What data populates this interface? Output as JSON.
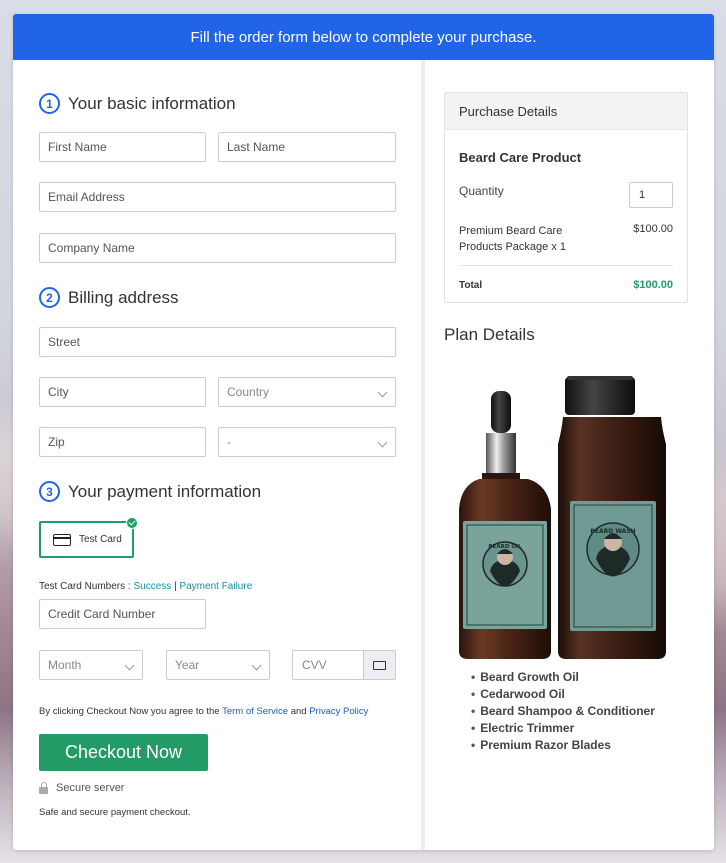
{
  "banner": {
    "text": "Fill the order form below to complete your purchase."
  },
  "basic_info": {
    "step": "1",
    "title": "Your basic information",
    "first_name_placeholder": "First Name",
    "last_name_placeholder": "Last Name",
    "email_placeholder": "Email Address",
    "company_placeholder": "Company Name"
  },
  "billing": {
    "step": "2",
    "title": "Billing address",
    "street_placeholder": "Street",
    "city_placeholder": "City",
    "country_selected": "Country",
    "zip_placeholder": "Zip",
    "state_selected": "-"
  },
  "payment": {
    "step": "3",
    "title": "Your payment information",
    "test_card_label": "Test Card",
    "test_numbers_prefix": "Test Card Numbers :",
    "success_link": "Success",
    "separator": "|",
    "failure_link": "Payment Failure",
    "card_number_placeholder": "Credit Card Number",
    "month_selected": "Month",
    "year_selected": "Year",
    "cvv_placeholder": "CVV"
  },
  "terms": {
    "prefix": "By clicking Checkout Now you agree to the",
    "tos_link": "Term of Service",
    "and": "and",
    "privacy_link": "Privacy Policy"
  },
  "checkout": {
    "button_label": "Checkout Now",
    "secure_label": "Secure server",
    "safe_text": "Safe and secure payment checkout."
  },
  "purchase_details": {
    "header": "Purchase Details",
    "product_name": "Beard Care Product",
    "quantity_label": "Quantity",
    "quantity_value": "1",
    "item_line1": "Premium Beard Care",
    "item_line2": "Products Package x 1",
    "item_price": "$100.00",
    "total_label": "Total",
    "total_value": "$100.00"
  },
  "plan_details": {
    "title": "Plan Details",
    "items": [
      "Beard Growth Oil",
      "Cedarwood Oil",
      "Beard Shampoo & Conditioner",
      "Electric Trimmer",
      "Premium Razor Blades"
    ]
  },
  "product_image": {
    "oil_label_line1": "BEARD OIL",
    "wash_label_line1": "BEARD WASH"
  },
  "colors": {
    "banner": "#2164e8",
    "accent_green": "#239b66",
    "link_teal": "#1a8fa0",
    "link_blue": "#1a5fb4"
  }
}
